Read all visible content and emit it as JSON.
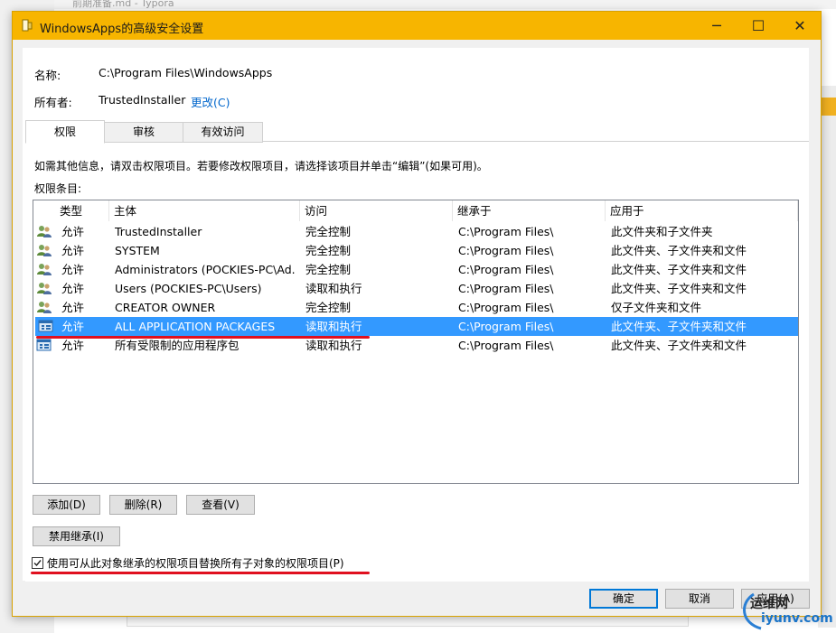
{
  "background": {
    "window_title": "前期准备.md - Typora"
  },
  "dialog": {
    "title": "WindowsApps的高级安全设置",
    "controls": {
      "minimize": "─",
      "maximize": "☐",
      "close": "✕"
    },
    "name_label": "名称:",
    "name_value": "C:\\Program Files\\WindowsApps",
    "owner_label": "所有者:",
    "owner_value": "TrustedInstaller",
    "owner_change_link": "更改(C)",
    "tabs": [
      {
        "label": "权限",
        "active": true
      },
      {
        "label": "审核",
        "active": false
      },
      {
        "label": "有效访问",
        "active": false
      }
    ],
    "info_text": "如需其他信息，请双击权限项目。若要修改权限项目，请选择该项目并单击“编辑”(如果可用)。",
    "entries_label": "权限条目:",
    "columns": [
      "类型",
      "主体",
      "访问",
      "继承于",
      "应用于"
    ],
    "rows": [
      {
        "icon": "user-group-icon",
        "type": "允许",
        "principal": "TrustedInstaller",
        "access": "完全控制",
        "inherited": "C:\\Program Files\\",
        "applies": "此文件夹和子文件夹",
        "selected": false
      },
      {
        "icon": "user-group-icon",
        "type": "允许",
        "principal": "SYSTEM",
        "access": "完全控制",
        "inherited": "C:\\Program Files\\",
        "applies": "此文件夹、子文件夹和文件",
        "selected": false
      },
      {
        "icon": "user-group-icon",
        "type": "允许",
        "principal": "Administrators (POCKIES-PC\\Ad...",
        "access": "完全控制",
        "inherited": "C:\\Program Files\\",
        "applies": "此文件夹、子文件夹和文件",
        "selected": false
      },
      {
        "icon": "user-group-icon",
        "type": "允许",
        "principal": "Users (POCKIES-PC\\Users)",
        "access": "读取和执行",
        "inherited": "C:\\Program Files\\",
        "applies": "此文件夹、子文件夹和文件",
        "selected": false
      },
      {
        "icon": "user-group-icon",
        "type": "允许",
        "principal": "CREATOR OWNER",
        "access": "完全控制",
        "inherited": "C:\\Program Files\\",
        "applies": "仅子文件夹和文件",
        "selected": false
      },
      {
        "icon": "app-package-icon",
        "type": "允许",
        "principal": "ALL APPLICATION PACKAGES",
        "access": "读取和执行",
        "inherited": "C:\\Program Files\\",
        "applies": "此文件夹、子文件夹和文件",
        "selected": true
      },
      {
        "icon": "app-package-icon",
        "type": "允许",
        "principal": "所有受限制的应用程序包",
        "access": "读取和执行",
        "inherited": "C:\\Program Files\\",
        "applies": "此文件夹、子文件夹和文件",
        "selected": false
      }
    ],
    "buttons": {
      "add": "添加(D)",
      "remove": "删除(R)",
      "view": "查看(V)",
      "disable_inheritance": "禁用继承(I)",
      "ok": "确定",
      "cancel": "取消",
      "apply": "应用(A)"
    },
    "replace_checkbox": {
      "label": "使用可从此对象继承的权限项目替换所有子对象的权限项目(P)",
      "checked": true
    }
  },
  "watermark": {
    "line1": "运维网",
    "line2": "iyunv.com"
  },
  "colors": {
    "titlebar": "#f7b500",
    "selection": "#3399ff",
    "link": "#0066cc",
    "annotation_red": "#e0101f"
  }
}
